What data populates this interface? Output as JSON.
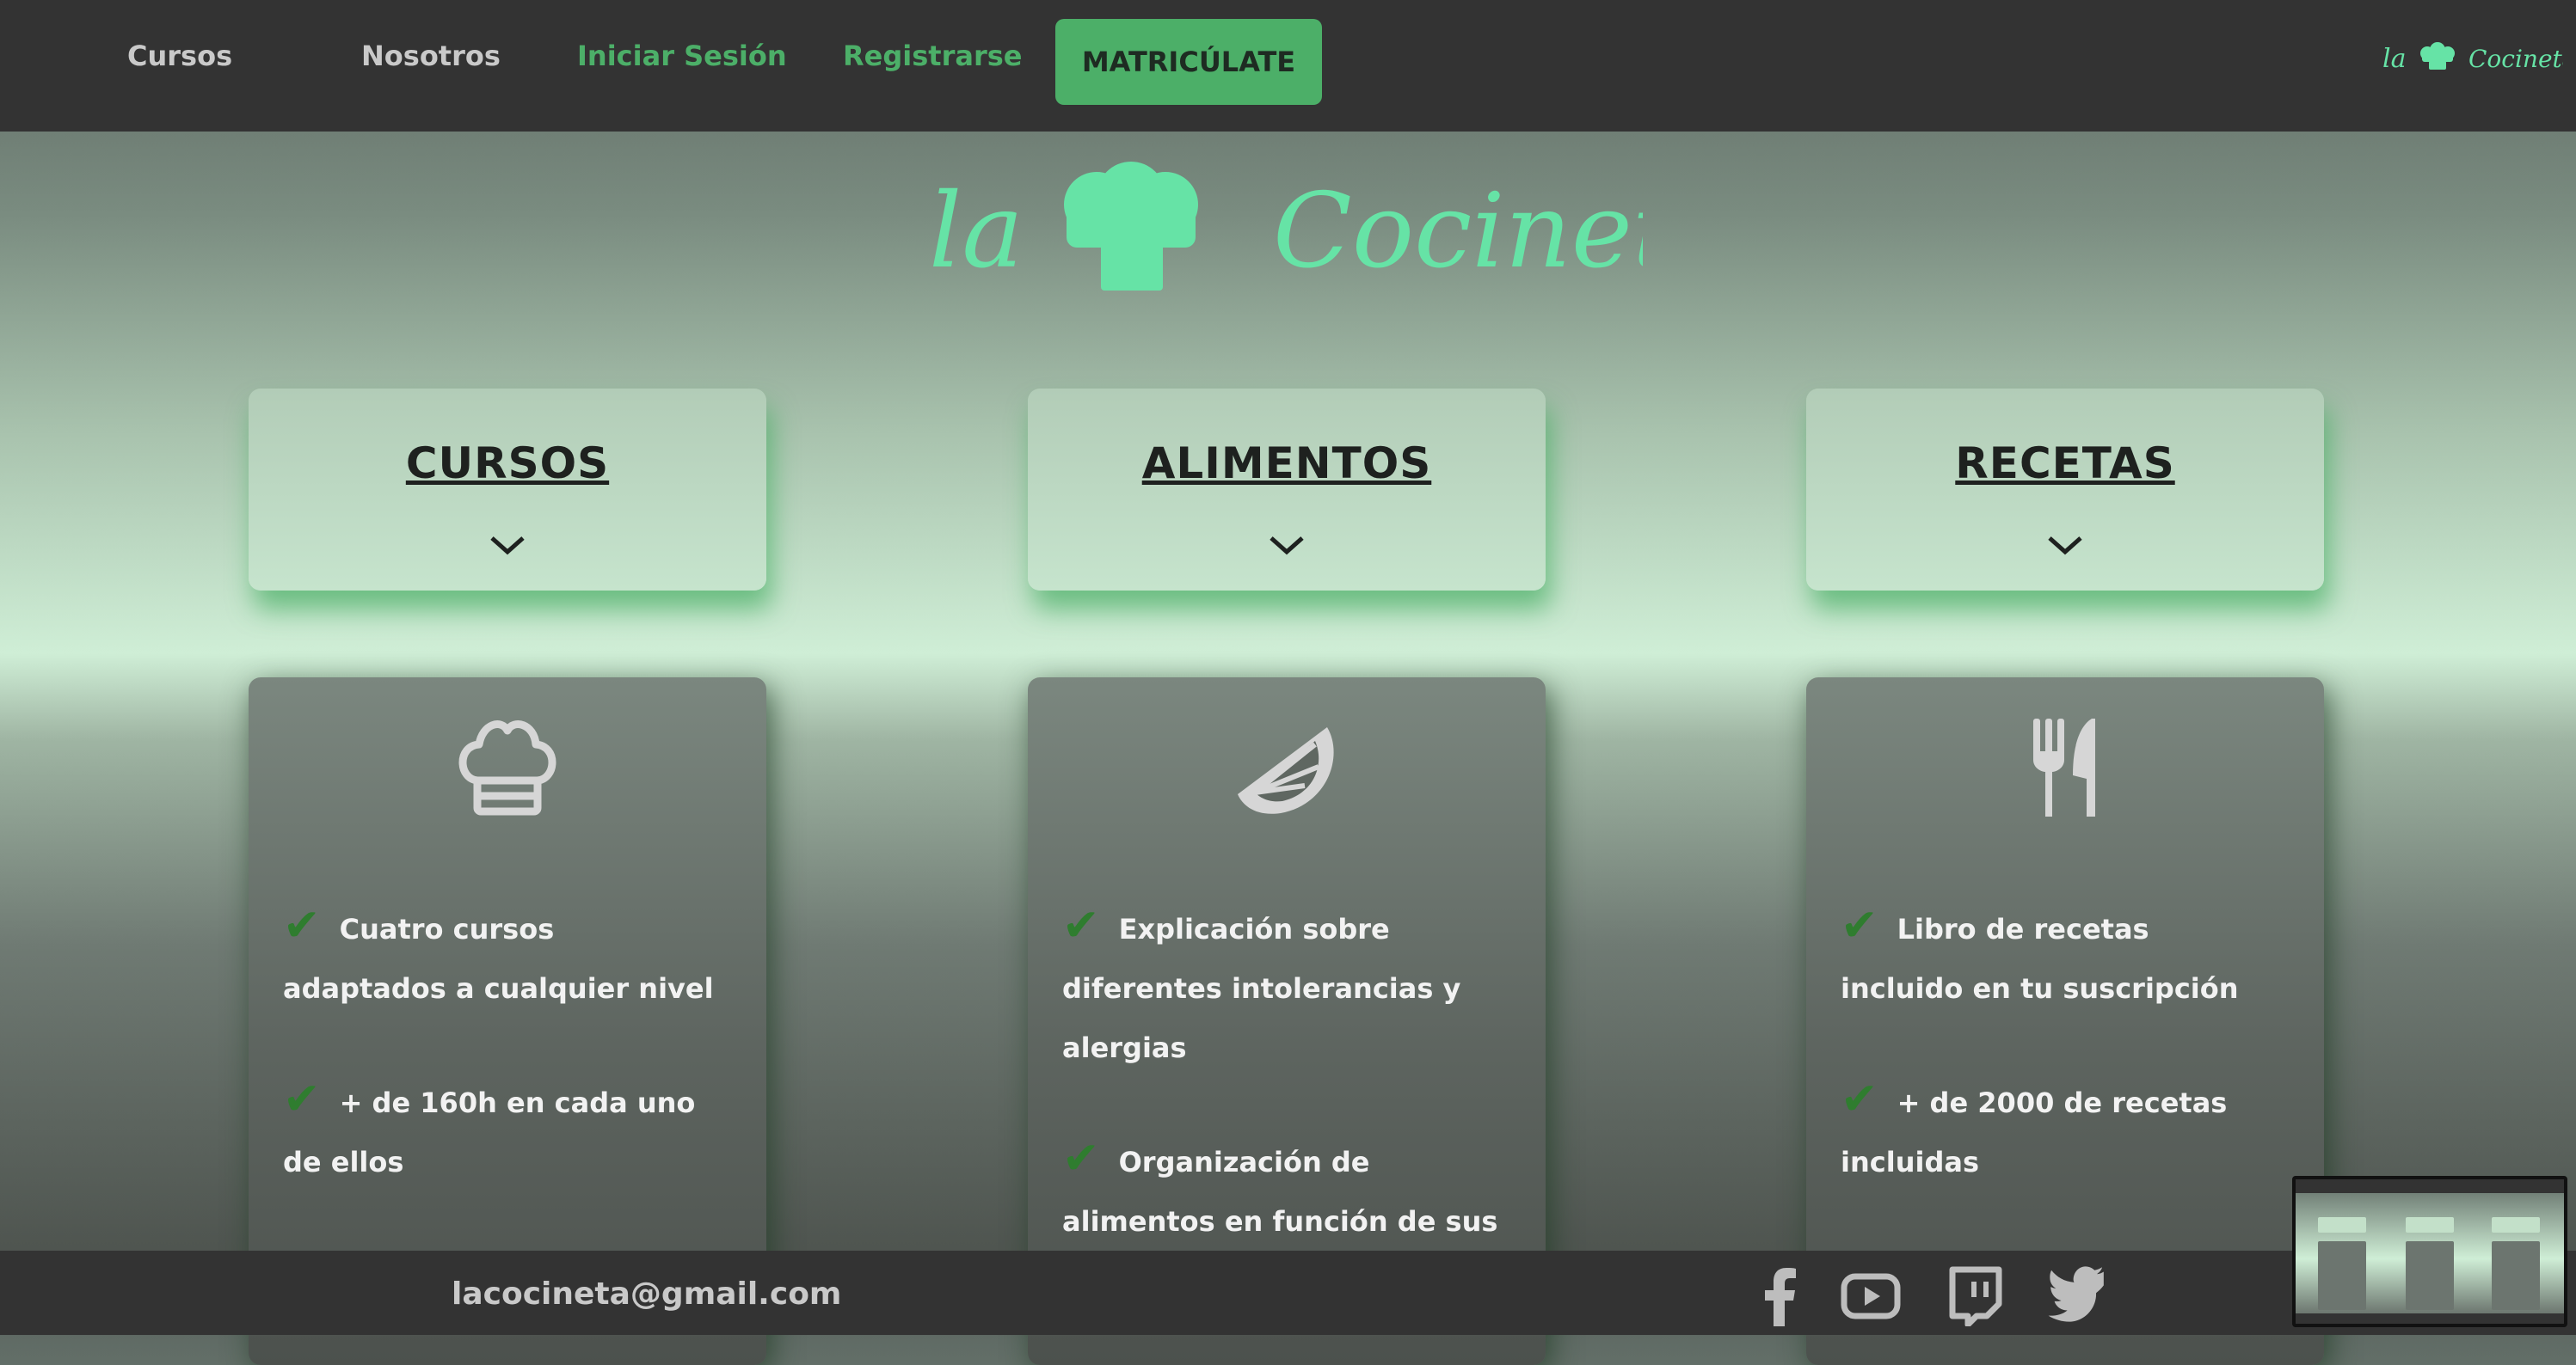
{
  "nav": {
    "links": [
      "Cursos",
      "Nosotros",
      "Iniciar Sesión",
      "Registrarse"
    ],
    "cta": "MATRICÚLATE"
  },
  "logo": {
    "pre": "la",
    "post": "Cocineta"
  },
  "categories": [
    {
      "title": "CURSOS"
    },
    {
      "title": "ALIMENTOS"
    },
    {
      "title": "RECETAS"
    }
  ],
  "cards": [
    {
      "icon": "chef-hat-icon",
      "features": [
        "Cuatro cursos adaptados a cualquier nivel",
        "+ de 160h en cada uno de ellos"
      ]
    },
    {
      "icon": "lemon-slice-icon",
      "features": [
        "Explicación sobre diferentes intolerancias y alergias",
        "Organización de alimentos en función de sus"
      ]
    },
    {
      "icon": "fork-knife-icon",
      "features": [
        "Libro de recetas incluido en tu suscripción",
        "+ de 2000 de recetas incluidas"
      ]
    }
  ],
  "check_glyph": "✔",
  "footer": {
    "email": "lacocineta@gmail.com",
    "social": [
      "facebook-icon",
      "youtube-icon",
      "twitch-icon",
      "twitter-icon"
    ]
  },
  "colors": {
    "accent": "#4caf68",
    "logo": "#66e3a6",
    "bar": "#333333",
    "check": "#2f7d2f"
  }
}
